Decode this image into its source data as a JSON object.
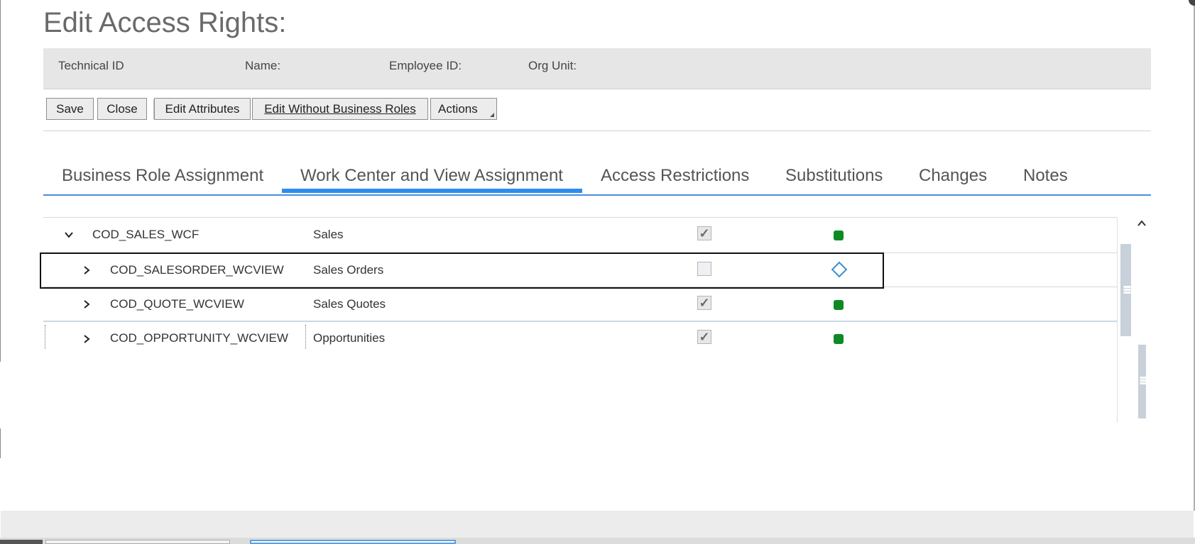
{
  "page": {
    "title": "Edit Access Rights:"
  },
  "info_bar": {
    "technical_id_label": "Technical ID",
    "name_label": "Name:",
    "employee_id_label": "Employee ID:",
    "org_unit_label": "Org Unit:"
  },
  "toolbar": {
    "save_label": "Save",
    "close_label": "Close",
    "edit_attributes_label": "Edit Attributes",
    "edit_without_roles_label": "Edit Without Business Roles",
    "actions_label": "Actions"
  },
  "tabs": [
    {
      "label": "Business Role Assignment",
      "active": false
    },
    {
      "label": "Work Center and View Assignment",
      "active": true
    },
    {
      "label": "Access Restrictions",
      "active": false
    },
    {
      "label": "Substitutions",
      "active": false
    },
    {
      "label": "Changes",
      "active": false
    },
    {
      "label": "Notes",
      "active": false
    }
  ],
  "rows": [
    {
      "id": "COD_SALES_WCF",
      "description": "Sales",
      "expanded": true,
      "assigned": true,
      "status": "green-dot-icon",
      "selected": false
    },
    {
      "id": "COD_SALESORDER_WCVIEW",
      "description": "Sales Orders",
      "expanded": false,
      "assigned": false,
      "status": "diamond-icon",
      "selected": true
    },
    {
      "id": "COD_QUOTE_WCVIEW",
      "description": "Sales Quotes",
      "expanded": false,
      "assigned": true,
      "status": "green-dot-icon",
      "selected": false
    },
    {
      "id": "COD_OPPORTUNITY_WCVIEW",
      "description": "Opportunities",
      "expanded": false,
      "assigned": true,
      "status": "green-dot-icon",
      "selected": false
    }
  ],
  "icons": {
    "checkmark": "✓",
    "status_green": "#0d8a24",
    "status_diamond": "#3a8fcf",
    "accent": "#2d8cf0"
  }
}
